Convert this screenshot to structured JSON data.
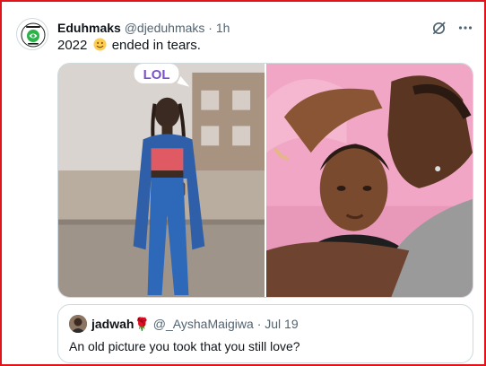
{
  "post": {
    "author_name": "Eduhmaks",
    "author_handle": "@djeduhmaks",
    "separator": "·",
    "time": "1h",
    "text_before_emoji": "2022",
    "emoji": "slightly-smiling-face",
    "text_after_emoji": "ended in tears.",
    "avatar_logo": "Eduhmaks"
  },
  "actions": {
    "grok_icon": "grok-icon",
    "more_icon": "more-icon"
  },
  "media": {
    "left_photo_sticker": "LOL",
    "photos": [
      "woman-in-denim-photo",
      "couple-selfie-photo"
    ]
  },
  "quote": {
    "author_name": "jadwah",
    "rose_emoji": "🌹",
    "author_handle": "@_AyshaMaigiwa",
    "separator": "·",
    "time": "Jul 19",
    "text": "An old picture you took that you still love?"
  },
  "colors": {
    "frame_border": "#e0151b",
    "secondary_text": "#536471",
    "primary_text": "#0f1419",
    "card_border": "#cfd9de"
  }
}
